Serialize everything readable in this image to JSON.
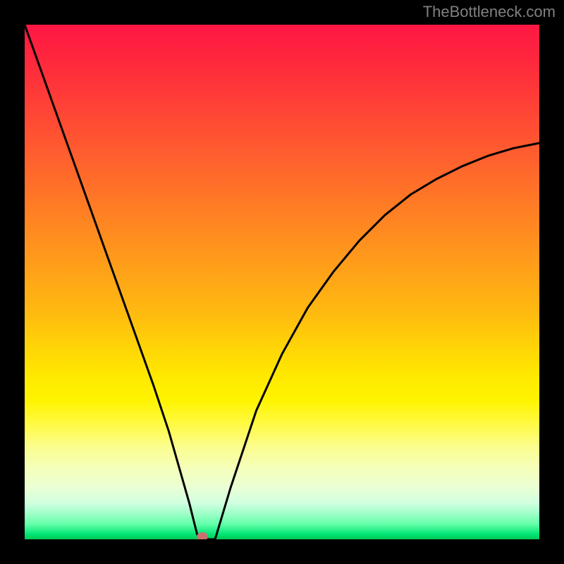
{
  "watermark": "TheBottleneck.com",
  "chart_data": {
    "type": "line",
    "title": "",
    "xlabel": "",
    "ylabel": "",
    "xlim": [
      0,
      100
    ],
    "ylim": [
      0,
      100
    ],
    "grid": false,
    "series": [
      {
        "name": "curve",
        "x": [
          0,
          5,
          10,
          15,
          20,
          25,
          28,
          30,
          32,
          33,
          33.5,
          34,
          37,
          40,
          45,
          50,
          55,
          60,
          65,
          70,
          75,
          80,
          85,
          90,
          95,
          100
        ],
        "values": [
          100,
          86,
          72,
          58,
          44,
          30,
          21,
          14,
          7,
          3,
          1,
          0,
          0,
          10,
          25,
          36,
          45,
          52,
          58,
          63,
          67,
          70,
          72.5,
          74.5,
          76,
          77
        ]
      }
    ],
    "marker": {
      "x": 34.5,
      "y": 0.5
    },
    "colors": {
      "curve_stroke": "#000000",
      "marker_fill": "#c77070",
      "gradient_top": "#ff1744",
      "gradient_bottom": "#00c853"
    }
  }
}
